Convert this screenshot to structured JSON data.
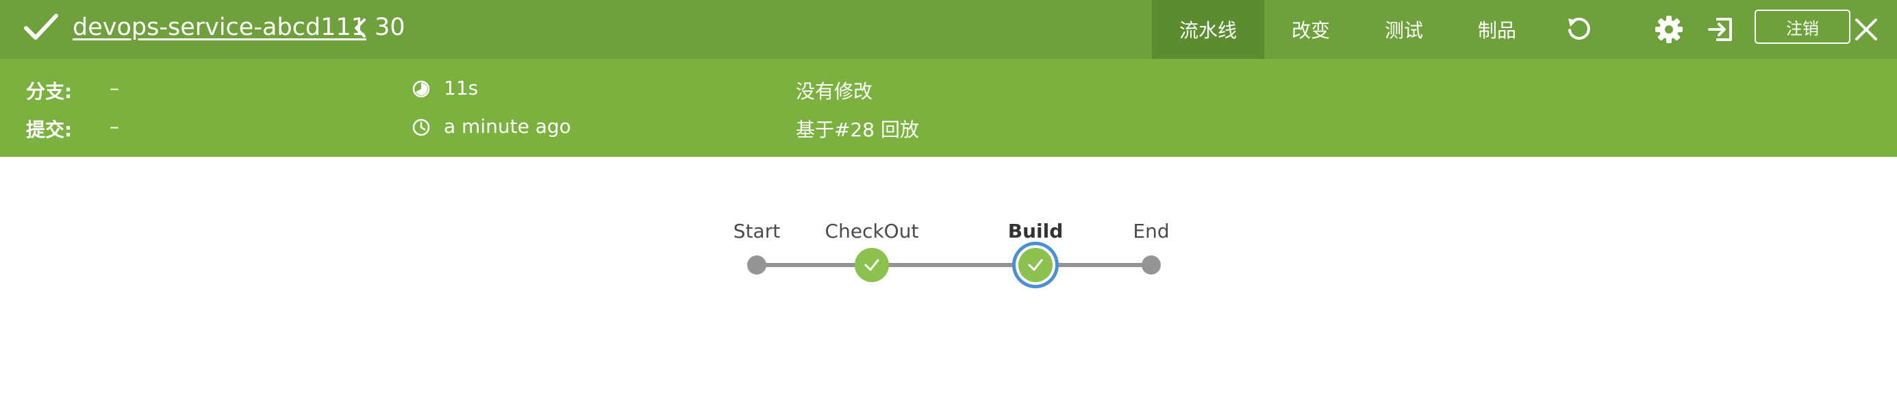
{
  "header": {
    "pipeline_name": "devops-service-abcd111",
    "run_number": "30",
    "tabs": [
      {
        "label": "流水线",
        "active": true
      },
      {
        "label": "改变",
        "active": false
      },
      {
        "label": "测试",
        "active": false
      },
      {
        "label": "制品",
        "active": false
      }
    ],
    "logout_label": "注销",
    "icons": [
      "check-icon",
      "chevron-left-icon",
      "replay-icon",
      "gear-icon",
      "exit-icon",
      "close-icon"
    ]
  },
  "info": {
    "branch_label": "分支:",
    "branch_value": "–",
    "commit_label": "提交:",
    "commit_value": "–",
    "duration": "11s",
    "time_ago": "a minute ago",
    "changes": "没有修改",
    "replay_of": "基于#28 回放"
  },
  "graph": {
    "stages": [
      {
        "name": "Start",
        "status": "none"
      },
      {
        "name": "CheckOut",
        "status": "success"
      },
      {
        "name": "Build",
        "status": "success",
        "selected": true
      },
      {
        "name": "End",
        "status": "none"
      }
    ]
  },
  "colors": {
    "header_bg": "#6ea13b",
    "active_tab_bg": "#5c8c30",
    "infobar_bg": "#7bb13f",
    "success": "#8cc04f",
    "selected_ring": "#4a90d9",
    "connector": "#949494"
  }
}
